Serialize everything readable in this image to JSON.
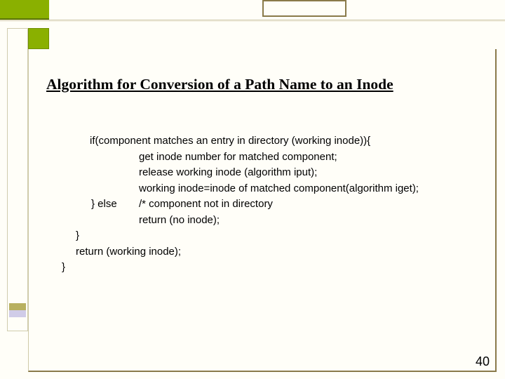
{
  "colors": {
    "olive_green": "#8ab000",
    "frame_brown": "#8a7a4a",
    "slide_bg": "#fffef8"
  },
  "slide": {
    "title": "Algorithm for Conversion of a Path Name to an Inode",
    "page_number": "40"
  },
  "code": {
    "l1": "if(component matches an entry in directory (working inode)){",
    "l2": "get inode number for matched component;",
    "l3": "release working inode (algorithm iput);",
    "l4": "working inode=inode of matched component(algorithm iget);",
    "l5a": "} else",
    "l5b": "/* component not in directory",
    "l6": "return (no inode);",
    "l7": "}",
    "l8": "return (working inode);",
    "l9": "}"
  }
}
